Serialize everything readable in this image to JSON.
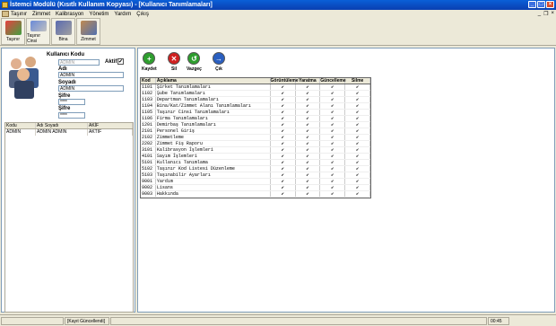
{
  "window": {
    "title": "İstemci Modülü (Kısıtlı Kullanım Kopyası) - [Kullanıcı Tanımlamaları]"
  },
  "menu": [
    "Taşınır",
    "Zimmet",
    "Kalibrasyon",
    "Yönetim",
    "Yardım",
    "Çıkış"
  ],
  "toolbar": [
    {
      "label": "Taşınır",
      "icon": "pencil-icon"
    },
    {
      "label": "Taşınır Cinsi",
      "icon": "network-icon"
    },
    {
      "label": "Bina",
      "icon": "building-icon"
    },
    {
      "label": "Zimmet",
      "icon": "person-icon"
    }
  ],
  "user_form": {
    "kullanici_kodu_label": "Kullanıcı Kodu",
    "kullanici_kodu_value": "ADMIN",
    "aktif_label": "Aktif",
    "adi_label": "Adı",
    "adi_value": "ADMIN",
    "soyadi_label": "Soyadı",
    "soyadi_value": "ADMIN",
    "sifre_label": "Şifre",
    "sifre_value": "****",
    "sifre2_label": "Şifre",
    "sifre2_value": "****"
  },
  "users_grid": {
    "headers": [
      "Kodu",
      "Adı Soyadı",
      "AKİF"
    ],
    "rows": [
      [
        "ADMIN",
        "ADMIN ADMIN",
        "AKTIF"
      ]
    ]
  },
  "actions": [
    {
      "label": "Kaydet",
      "color": "#2e9e2e",
      "glyph": "+"
    },
    {
      "label": "Sil",
      "color": "#d02020",
      "glyph": "✕"
    },
    {
      "label": "Vazgeç",
      "color": "#2e9e2e",
      "glyph": "↺"
    },
    {
      "label": "Çık",
      "color": "#2a5fc0",
      "glyph": "→"
    }
  ],
  "perm_grid": {
    "headers": [
      "Kod",
      "Açıklama",
      "Görüntüleme",
      "Yaratma",
      "Güncelleme",
      "Silme"
    ],
    "rows": [
      [
        "1101",
        "Şirket Tanımlamaları"
      ],
      [
        "1102",
        "Şube Tanımlamaları"
      ],
      [
        "1103",
        "Departman Tanımlamaları"
      ],
      [
        "1104",
        "Bina/Kat/Zimmet Alanı Tanımlamaları"
      ],
      [
        "1105",
        "Taşınır Cinsi Tanımlamaları"
      ],
      [
        "1106",
        "Firma Tanımlamaları"
      ],
      [
        "1201",
        "Demirbaş Tanımlamaları"
      ],
      [
        "2101",
        "Personel Giriş"
      ],
      [
        "2102",
        "Zimmetleme"
      ],
      [
        "2202",
        "Zimmet Fiş Raporu"
      ],
      [
        "3101",
        "Kalibrasyon İşlemleri"
      ],
      [
        "4101",
        "Sayım İşlemleri"
      ],
      [
        "5101",
        "Kullanıcı Tanımlama"
      ],
      [
        "5102",
        "Taşınır Kod Listesi Düzenleme"
      ],
      [
        "5103",
        "Taşınabilir Ayarları"
      ],
      [
        "9001",
        "Yardım"
      ],
      [
        "9002",
        "Lisans"
      ],
      [
        "9003",
        "Hakkında"
      ]
    ],
    "check": "✔"
  },
  "status": {
    "text": "[Kayıt Güncellendi]",
    "time": "00:45"
  }
}
